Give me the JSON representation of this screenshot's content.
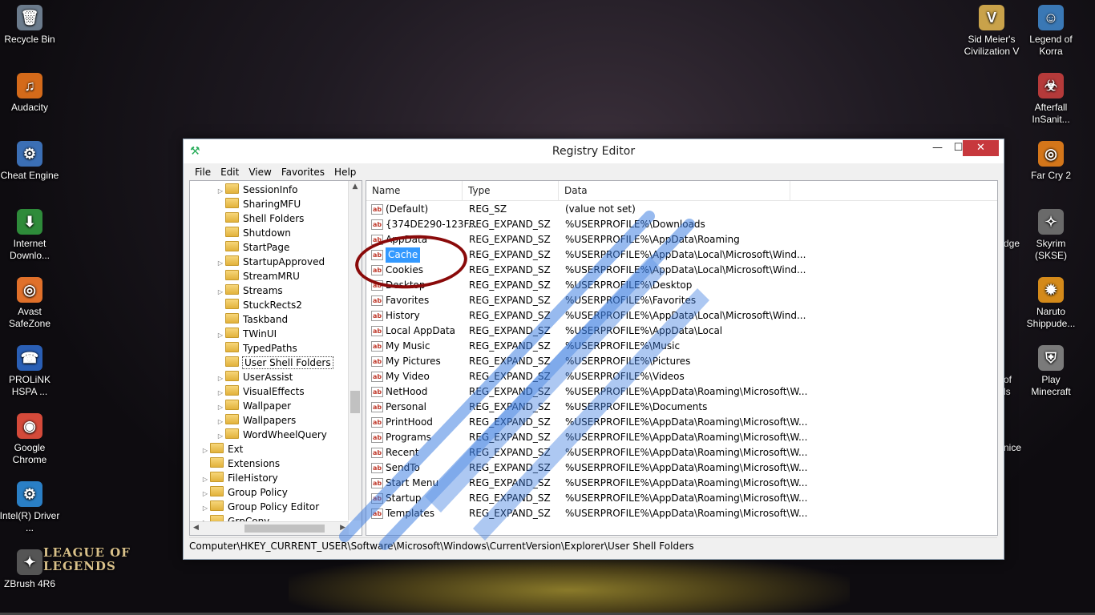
{
  "desktop": {
    "left_icons": [
      {
        "label": "Recycle Bin",
        "glyph": "🗑",
        "color": "#6b7b8c"
      },
      {
        "label": "Audacity",
        "glyph": "♫",
        "color": "#d46a1a"
      },
      {
        "label": "Cheat Engine",
        "glyph": "⚙",
        "color": "#3b6fb5"
      },
      {
        "label": "Internet Downlo...",
        "glyph": "⬇",
        "color": "#2e8b3a"
      },
      {
        "label": "Avast SafeZone",
        "glyph": "◎",
        "color": "#e0702a"
      },
      {
        "label": "PROLiNK HSPA ...",
        "glyph": "☎",
        "color": "#2a5fb5"
      },
      {
        "label": "Google Chrome",
        "glyph": "◉",
        "color": "#d44a3a"
      },
      {
        "label": "Intel(R) Driver ...",
        "glyph": "⚙",
        "color": "#2a7fc5"
      },
      {
        "label": "ZBrush 4R6",
        "glyph": "✦",
        "color": "#555555"
      }
    ],
    "right_icons": [
      {
        "label": "Sid Meier's Civilization V",
        "glyph": "V",
        "color": "#c9a24a"
      },
      {
        "label": "Legend of Korra",
        "glyph": "☺",
        "color": "#3a78b5"
      },
      {
        "label": "Afterfall InSanit...",
        "glyph": "☣",
        "color": "#b53a3a"
      },
      {
        "label": "Far Cry 2",
        "glyph": "◎",
        "color": "#d4761a"
      },
      {
        "label": "Skyrim (SKSE)",
        "glyph": "✧",
        "color": "#6a6a6a"
      },
      {
        "label": "Naruto Shippude...",
        "glyph": "✹",
        "color": "#d48a1a"
      },
      {
        "label": "Play Minecraft",
        "glyph": "⛨",
        "color": "#7a7a7a"
      }
    ],
    "logo_text": "LEAGUE OF LEGENDS",
    "partial_labels": [
      "dge",
      "of",
      "ls",
      "nice"
    ]
  },
  "window": {
    "title": "Registry Editor",
    "controls": {
      "minimize": "—",
      "maximize": "☐",
      "close": "✕"
    },
    "menu": [
      "File",
      "Edit",
      "View",
      "Favorites",
      "Help"
    ]
  },
  "tree": {
    "items": [
      {
        "label": "SessionInfo",
        "indent": 2,
        "arrow": true
      },
      {
        "label": "SharingMFU",
        "indent": 2,
        "arrow": false
      },
      {
        "label": "Shell Folders",
        "indent": 2,
        "arrow": false
      },
      {
        "label": "Shutdown",
        "indent": 2,
        "arrow": false
      },
      {
        "label": "StartPage",
        "indent": 2,
        "arrow": false
      },
      {
        "label": "StartupApproved",
        "indent": 2,
        "arrow": true
      },
      {
        "label": "StreamMRU",
        "indent": 2,
        "arrow": false
      },
      {
        "label": "Streams",
        "indent": 2,
        "arrow": true
      },
      {
        "label": "StuckRects2",
        "indent": 2,
        "arrow": false
      },
      {
        "label": "Taskband",
        "indent": 2,
        "arrow": false
      },
      {
        "label": "TWinUI",
        "indent": 2,
        "arrow": true
      },
      {
        "label": "TypedPaths",
        "indent": 2,
        "arrow": false
      },
      {
        "label": "User Shell Folders",
        "indent": 2,
        "arrow": false,
        "selected": true
      },
      {
        "label": "UserAssist",
        "indent": 2,
        "arrow": true
      },
      {
        "label": "VisualEffects",
        "indent": 2,
        "arrow": true
      },
      {
        "label": "Wallpaper",
        "indent": 2,
        "arrow": true
      },
      {
        "label": "Wallpapers",
        "indent": 2,
        "arrow": true
      },
      {
        "label": "WordWheelQuery",
        "indent": 2,
        "arrow": true
      },
      {
        "label": "Ext",
        "indent": 1,
        "arrow": true
      },
      {
        "label": "Extensions",
        "indent": 1,
        "arrow": false
      },
      {
        "label": "FileHistory",
        "indent": 1,
        "arrow": true
      },
      {
        "label": "Group Policy",
        "indent": 1,
        "arrow": true
      },
      {
        "label": "Group Policy Editor",
        "indent": 1,
        "arrow": true
      },
      {
        "label": "GrpConv",
        "indent": 1,
        "arrow": true
      }
    ]
  },
  "values": {
    "headers": {
      "name": "Name",
      "type": "Type",
      "data": "Data"
    },
    "rows": [
      {
        "name": "(Default)",
        "type": "REG_SZ",
        "data": "(value not set)"
      },
      {
        "name": "{374DE290-123F...",
        "type": "REG_EXPAND_SZ",
        "data": "%USERPROFILE%\\Downloads"
      },
      {
        "name": "AppData",
        "type": "REG_EXPAND_SZ",
        "data": "%USERPROFILE%\\AppData\\Roaming"
      },
      {
        "name": "Cache",
        "type": "REG_EXPAND_SZ",
        "data": "%USERPROFILE%\\AppData\\Local\\Microsoft\\Wind...",
        "selected": true
      },
      {
        "name": "Cookies",
        "type": "REG_EXPAND_SZ",
        "data": "%USERPROFILE%\\AppData\\Local\\Microsoft\\Wind..."
      },
      {
        "name": "Desktop",
        "type": "REG_EXPAND_SZ",
        "data": "%USERPROFILE%\\Desktop"
      },
      {
        "name": "Favorites",
        "type": "REG_EXPAND_SZ",
        "data": "%USERPROFILE%\\Favorites"
      },
      {
        "name": "History",
        "type": "REG_EXPAND_SZ",
        "data": "%USERPROFILE%\\AppData\\Local\\Microsoft\\Wind..."
      },
      {
        "name": "Local AppData",
        "type": "REG_EXPAND_SZ",
        "data": "%USERPROFILE%\\AppData\\Local"
      },
      {
        "name": "My Music",
        "type": "REG_EXPAND_SZ",
        "data": "%USERPROFILE%\\Music"
      },
      {
        "name": "My Pictures",
        "type": "REG_EXPAND_SZ",
        "data": "%USERPROFILE%\\Pictures"
      },
      {
        "name": "My Video",
        "type": "REG_EXPAND_SZ",
        "data": "%USERPROFILE%\\Videos"
      },
      {
        "name": "NetHood",
        "type": "REG_EXPAND_SZ",
        "data": "%USERPROFILE%\\AppData\\Roaming\\Microsoft\\W..."
      },
      {
        "name": "Personal",
        "type": "REG_EXPAND_SZ",
        "data": "%USERPROFILE%\\Documents"
      },
      {
        "name": "PrintHood",
        "type": "REG_EXPAND_SZ",
        "data": "%USERPROFILE%\\AppData\\Roaming\\Microsoft\\W..."
      },
      {
        "name": "Programs",
        "type": "REG_EXPAND_SZ",
        "data": "%USERPROFILE%\\AppData\\Roaming\\Microsoft\\W..."
      },
      {
        "name": "Recent",
        "type": "REG_EXPAND_SZ",
        "data": "%USERPROFILE%\\AppData\\Roaming\\Microsoft\\W..."
      },
      {
        "name": "SendTo",
        "type": "REG_EXPAND_SZ",
        "data": "%USERPROFILE%\\AppData\\Roaming\\Microsoft\\W..."
      },
      {
        "name": "Start Menu",
        "type": "REG_EXPAND_SZ",
        "data": "%USERPROFILE%\\AppData\\Roaming\\Microsoft\\W..."
      },
      {
        "name": "Startup",
        "type": "REG_EXPAND_SZ",
        "data": "%USERPROFILE%\\AppData\\Roaming\\Microsoft\\W..."
      },
      {
        "name": "Templates",
        "type": "REG_EXPAND_SZ",
        "data": "%USERPROFILE%\\AppData\\Roaming\\Microsoft\\W..."
      }
    ]
  },
  "statusbar": {
    "path": "Computer\\HKEY_CURRENT_USER\\Software\\Microsoft\\Windows\\CurrentVersion\\Explorer\\User Shell Folders"
  },
  "colors": {
    "selection": "#3399ff",
    "close_button": "#c7383d",
    "annotation": "#8a0a0a",
    "watermark": "#3a7be0"
  }
}
